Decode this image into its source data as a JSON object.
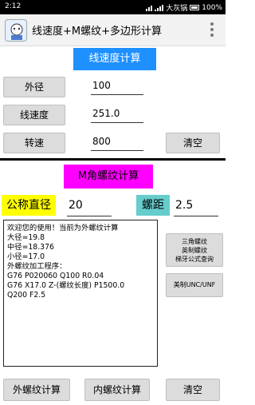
{
  "status_bar": {
    "time": "2:12",
    "carrier": "大灰锅",
    "battery": "100%"
  },
  "app_bar": {
    "title": "线速度+M螺纹+多边形计算",
    "logo_icon": "app-logo-icon",
    "menu_icon": "overflow-menu-icon"
  },
  "speed_section": {
    "header": "线速度计算",
    "outer_diameter_label": "外径",
    "outer_diameter_value": "100",
    "linear_speed_label": "线速度",
    "linear_speed_value": "251.0",
    "rpm_label": "转速",
    "rpm_value": "800",
    "clear_label": "清空"
  },
  "thread_section": {
    "header": "M角螺纹计算",
    "nominal_diameter_label": "公称直径",
    "nominal_diameter_value": "20",
    "pitch_label": "螺距",
    "pitch_value": "2.5",
    "output_text": "欢迎您的使用！当前为外螺纹计算\n大径=19.8\n中径=18.376\n小径=17.0\n外螺纹加工程序：\nG76 P020060 Q100 R0.04\nG76 X17.0 Z-(螺纹长度) P1500.0\nQ200 F2.5",
    "side_button_1": "三角螺纹\n英制螺纹\n梯牙公式查询",
    "side_button_2": "美制UNC/UNF",
    "external_thread_label": "外螺纹计算",
    "internal_thread_label": "内螺纹计算",
    "clear_label": "清空"
  },
  "colors": {
    "header1_bg": "#1e90ff",
    "header2_bg": "#ff00ff",
    "label_yellow": "#ffff00",
    "label_cyan": "#66cccc"
  }
}
